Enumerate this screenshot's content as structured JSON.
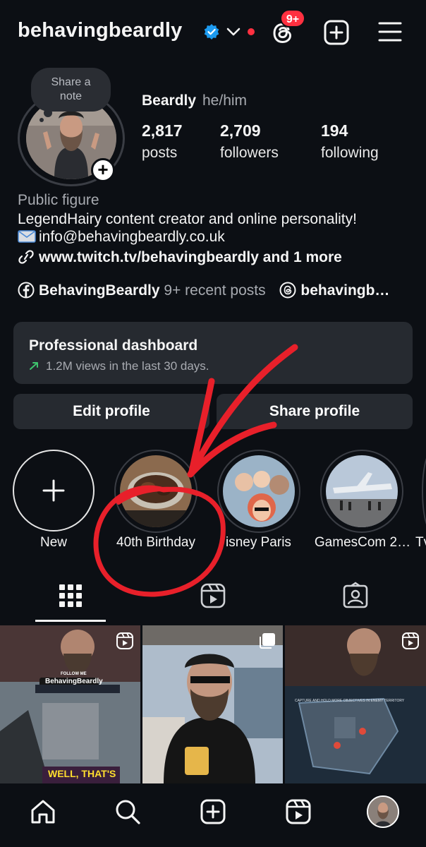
{
  "header": {
    "username": "behavingbeardly",
    "notification_badge": "9+",
    "icons": [
      "verified-badge-icon",
      "chevron-down-icon",
      "threads-icon",
      "add-post-icon",
      "menu-icon"
    ]
  },
  "profile": {
    "note_prompt": "Share a\nnote",
    "name": "Beardly",
    "pronouns": "he/him",
    "stats": [
      {
        "value": "2,817",
        "label": "posts"
      },
      {
        "value": "2,709",
        "label": "followers"
      },
      {
        "value": "194",
        "label": "following"
      }
    ],
    "category": "Public figure",
    "bio": "LegendHairy content creator and online personality!",
    "email": "info@behavingbeardly.co.uk",
    "link": "www.twitch.tv/behavingbeardly and 1 more",
    "facebook_name": "BehavingBeardly",
    "facebook_recent": "9+ recent posts",
    "threads_name": "behavingb…"
  },
  "dashboard": {
    "title": "Professional dashboard",
    "subtitle": "1.2M views in the last 30 days."
  },
  "actions": {
    "edit": "Edit profile",
    "share": "Share profile"
  },
  "highlights": [
    {
      "label": "New"
    },
    {
      "label": "40th Birthday"
    },
    {
      "label": "isney Paris"
    },
    {
      "label": "GamesCom 2…"
    },
    {
      "label": "Tv"
    }
  ],
  "tabs": [
    "grid-icon",
    "reels-icon",
    "tagged-icon"
  ],
  "grid_tiles": [
    {
      "caption_top": "FOLLOW ME",
      "caption_name": "BehavingBeardly",
      "caption_bottom": "WELL, THAT'S",
      "badge": "reels-icon"
    },
    {
      "badge": "carousel-icon"
    },
    {
      "caption_map": "CAPTURE AND HOLD MORE OBJECTIVES IN ENEMY TERRITORY",
      "badge": "reels-icon"
    }
  ],
  "colors": {
    "background": "#0c0f14",
    "surface": "#262a30",
    "secondary_text": "#a8abb1",
    "notification": "#ff3040",
    "verified": "#1d9bf0",
    "annotation": "#e8202a"
  }
}
